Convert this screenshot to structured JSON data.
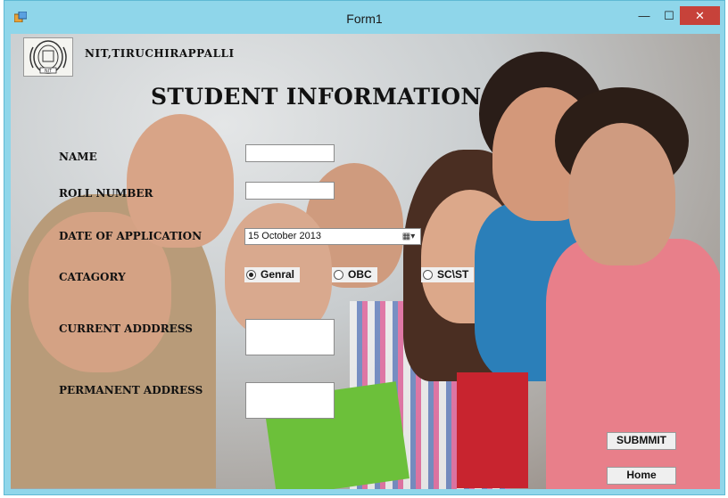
{
  "window": {
    "title": "Form1",
    "minimize": "—",
    "maximize": "☐",
    "close": "✕",
    "close_color": "#c7423a"
  },
  "header": {
    "logo_text": "NIT",
    "institute": "NIT,TIRUCHIRAPPALLI",
    "title": "STUDENT INFORMATION"
  },
  "form": {
    "labels": {
      "name": "NAME",
      "roll_number": "ROLL NUMBER",
      "date_of_application": "DATE OF APPLICATION",
      "category": "CATAGORY",
      "current_address": "CURRENT ADDDRESS",
      "permanent_address": "PERMANENT ADDRESS"
    },
    "name_value": "",
    "roll_number_value": "",
    "date_value": "15  October   2013",
    "date_button_icon": "calendar-dropdown-icon",
    "current_address_value": "",
    "permanent_address_value": "",
    "category_options": [
      {
        "label": "Genral",
        "selected": true
      },
      {
        "label": "OBC",
        "selected": false
      },
      {
        "label": "SC\\ST",
        "selected": false
      }
    ],
    "submit_label": "SUBMMIT",
    "home_label": "Home"
  }
}
